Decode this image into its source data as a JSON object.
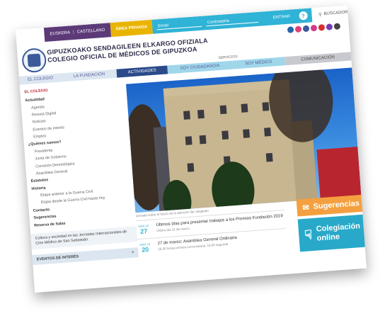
{
  "topbar": {
    "lang_eu": "EUSKERA",
    "lang_es": "CASTELLANO",
    "private_area": "ÁREA PRIVADA",
    "email_placeholder": "Email",
    "password_placeholder": "Contraseña",
    "enter": "ENTRAR",
    "help": "?",
    "search": "BUSCADOR",
    "search_icon": "magnifier-icon"
  },
  "socials": [
    {
      "name": "linkedin-icon",
      "color": "#2467a8"
    },
    {
      "name": "flickr-icon",
      "color": "#e0407a"
    },
    {
      "name": "facebook-icon",
      "color": "#3b5aa0"
    },
    {
      "name": "instagram-icon",
      "color": "#d23a8a"
    },
    {
      "name": "youtube-icon",
      "color": "#d82f2f"
    },
    {
      "name": "podcast-icon",
      "color": "#7a3ab8"
    },
    {
      "name": "rss-icon",
      "color": "#444444"
    }
  ],
  "header": {
    "title_line1": "GIPUZKOAKO SENDAGILEEN ELKARGO OFIZIALA",
    "title_line2": "COLEGIO OFICIAL DE MÉDICOS DE GIPUZKOA",
    "services": "SERVICIOS"
  },
  "nav": {
    "colegio": "EL COLEGIO",
    "fundacion": "LA FUNDACIÓN",
    "actividades": "ACTIVIDADES",
    "ciudadano": "SOY CIUDADANO/A",
    "medico": "SOY MÉDICO",
    "comunicacion": "COMUNICACIÓN"
  },
  "sidebar": {
    "head": "EL COLEGIO",
    "actualidad": "Actualidad",
    "agenda": "Agenda",
    "revista": "Revista Digital",
    "noticias": "Noticias",
    "eventos": "Eventos de interés",
    "empleo": "Empleo",
    "quienes": "¿Quiénes somos?",
    "presidente": "Presidente",
    "junta": "Junta de Gobierno",
    "comision": "Comisión Deontológica",
    "asamblea": "Asamblea General",
    "estatutos": "Estatutos",
    "historia": "Historia",
    "etapa1": "Etapa anterior a la Guerra Civil",
    "etapa2": "Etapa desde la Guerra Civil hasta hoy",
    "contacto": "Contacto",
    "sugerencias": "Sugerencias",
    "reserva": "Reserva de Salas",
    "news_text": "Cultura y sociedad en las Jornadas Internacionales de Cine Médico de San Sebastián.",
    "interest_title": "EVENTOS DE INTERÉS",
    "interest_plus": "+"
  },
  "events": {
    "prev_text": "Jornada sobre el futuro de la atención del colegiado",
    "items": [
      {
        "month": "MAR 19",
        "day": "27",
        "title": "Últimos días para presentar trabajos a los Premios Fundación 2019",
        "sub": "Último día 31 de marzo"
      },
      {
        "month": "MAR 19",
        "day": "20",
        "title": "27 de marzo: Asamblea General Ordinaria",
        "sub": "18.30 horas primera convocatoria, 19.00 segunda"
      }
    ]
  },
  "boxes": {
    "sugerencias": "Sugerencias",
    "colegiacion_1": "Colegiación",
    "colegiacion_2": "online"
  }
}
